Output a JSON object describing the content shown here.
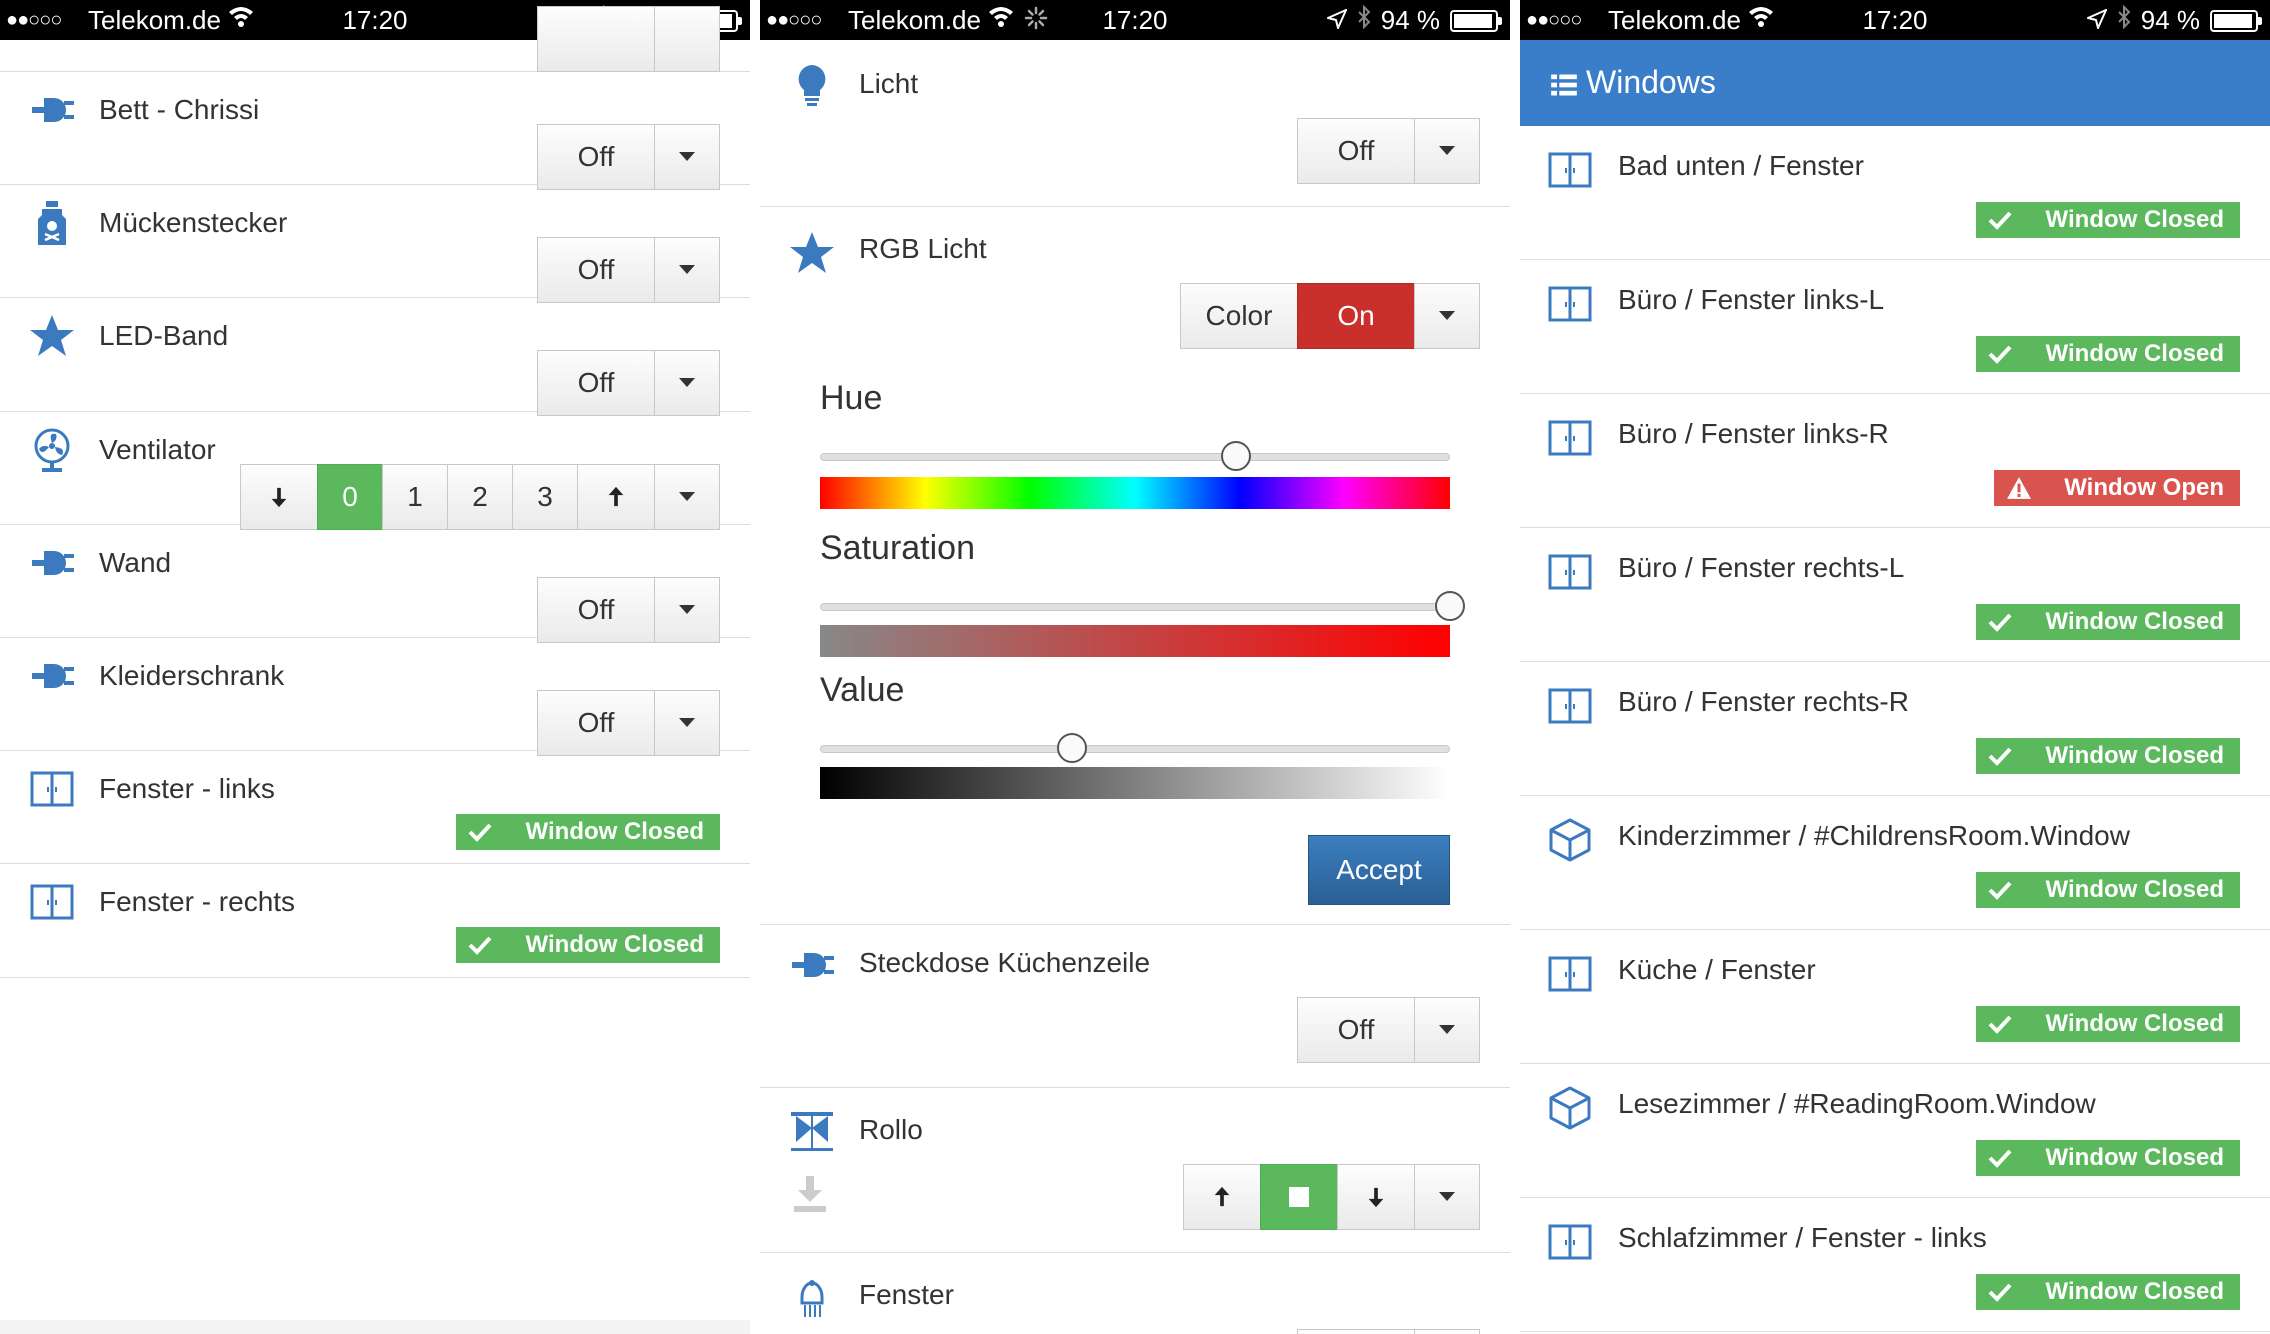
{
  "statusbar": {
    "signal": "●●○○○",
    "carrier": "Telekom.de",
    "time": "17:20",
    "battery": "94 %",
    "battery_level": 0.94
  },
  "panel1": {
    "rows": [
      {
        "label": "Bett - Chrissi",
        "icon": "plug-icon",
        "state": "Off"
      },
      {
        "label": "Mückenstecker",
        "icon": "poison-bottle-icon",
        "state": "Off"
      },
      {
        "label": "LED-Band",
        "icon": "star-icon",
        "state": "Off"
      },
      {
        "label": "Ventilator",
        "icon": "fan-icon",
        "levels": [
          "0",
          "1",
          "2",
          "3"
        ],
        "active_level": "0"
      },
      {
        "label": "Wand",
        "icon": "plug-icon",
        "state": "Off"
      },
      {
        "label": "Kleiderschrank",
        "icon": "plug-icon",
        "state": "Off"
      },
      {
        "label": "Fenster - links",
        "icon": "window-icon",
        "status": "Window Closed"
      },
      {
        "label": "Fenster - rechts",
        "icon": "window-icon",
        "status": "Window Closed"
      }
    ]
  },
  "panel2": {
    "licht": {
      "label": "Licht",
      "icon": "lightbulb-icon",
      "state": "Off"
    },
    "rgb": {
      "label": "RGB Licht",
      "icon": "star-icon",
      "color_btn": "Color",
      "state": "On"
    },
    "picker": {
      "hue_label": "Hue",
      "hue": 0.66,
      "saturation_label": "Saturation",
      "saturation": 1.0,
      "value_label": "Value",
      "value": 0.4,
      "accept": "Accept"
    },
    "steckdose": {
      "label": "Steckdose Küchenzeile",
      "icon": "plug-icon",
      "state": "Off"
    },
    "rollo": {
      "label": "Rollo",
      "icon": "blinds-icon"
    },
    "fenster": {
      "label": "Fenster",
      "icon": "window-sensor-icon"
    }
  },
  "panel3": {
    "title": "Windows",
    "rows": [
      {
        "label": "Bad unten / Fenster",
        "icon": "window-icon",
        "status": "Window Closed",
        "ok": true
      },
      {
        "label": "Büro / Fenster links-L",
        "icon": "window-icon",
        "status": "Window Closed",
        "ok": true
      },
      {
        "label": "Büro / Fenster links-R",
        "icon": "window-icon",
        "status": "Window Open",
        "ok": false
      },
      {
        "label": "Büro / Fenster rechts-L",
        "icon": "window-icon",
        "status": "Window Closed",
        "ok": true
      },
      {
        "label": "Büro / Fenster rechts-R",
        "icon": "window-icon",
        "status": "Window Closed",
        "ok": true
      },
      {
        "label": "Kinderzimmer / #ChildrensRoom.Window",
        "icon": "cube-icon",
        "status": "Window Closed",
        "ok": true
      },
      {
        "label": "Küche / Fenster",
        "icon": "window-icon",
        "status": "Window Closed",
        "ok": true
      },
      {
        "label": "Lesezimmer / #ReadingRoom.Window",
        "icon": "cube-icon",
        "status": "Window Closed",
        "ok": true
      },
      {
        "label": "Schlafzimmer / Fenster - links",
        "icon": "window-icon",
        "status": "Window Closed",
        "ok": true
      }
    ]
  },
  "colors": {
    "accent": "#3c7abf",
    "header": "#3a7dc9",
    "success": "#5cb85c",
    "danger": "#d9534f",
    "on_red": "#c9302c"
  }
}
